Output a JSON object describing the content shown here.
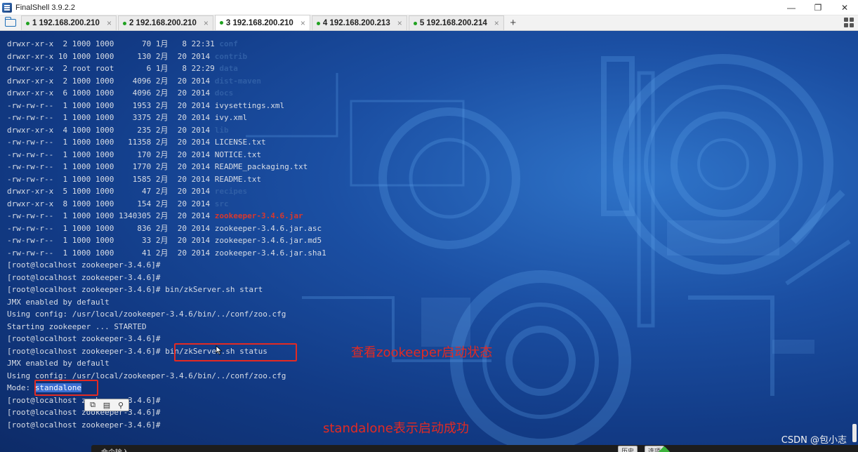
{
  "window": {
    "title": "FinalShell 3.9.2.2",
    "controls": {
      "minimize": "—",
      "maximize": "❐",
      "close": "✕"
    }
  },
  "tabs": [
    {
      "label": "1 192.168.200.210",
      "active": false,
      "close": "×"
    },
    {
      "label": "2 192.168.200.210",
      "active": false,
      "close": "×"
    },
    {
      "label": "3 192.168.200.210",
      "active": true,
      "close": "×"
    },
    {
      "label": "4 192.168.200.213",
      "active": false,
      "close": "×"
    },
    {
      "label": "5 192.168.200.214",
      "active": false,
      "close": "×"
    }
  ],
  "tab_add": "+",
  "terminal": {
    "listing": [
      {
        "meta": "drwxr-xr-x  2 1000 1000      70 1月   8 22:31 ",
        "name": "conf",
        "kind": "dir"
      },
      {
        "meta": "drwxr-xr-x 10 1000 1000     130 2月  20 2014 ",
        "name": "contrib",
        "kind": "dir"
      },
      {
        "meta": "drwxr-xr-x  2 root root       6 1月   8 22:29 ",
        "name": "data",
        "kind": "dir"
      },
      {
        "meta": "drwxr-xr-x  2 1000 1000    4096 2月  20 2014 ",
        "name": "dist-maven",
        "kind": "dir"
      },
      {
        "meta": "drwxr-xr-x  6 1000 1000    4096 2月  20 2014 ",
        "name": "docs",
        "kind": "dir"
      },
      {
        "meta": "-rw-rw-r--  1 1000 1000    1953 2月  20 2014 ",
        "name": "ivysettings.xml",
        "kind": "file"
      },
      {
        "meta": "-rw-rw-r--  1 1000 1000    3375 2月  20 2014 ",
        "name": "ivy.xml",
        "kind": "file"
      },
      {
        "meta": "drwxr-xr-x  4 1000 1000     235 2月  20 2014 ",
        "name": "lib",
        "kind": "dir"
      },
      {
        "meta": "-rw-rw-r--  1 1000 1000   11358 2月  20 2014 ",
        "name": "LICENSE.txt",
        "kind": "file"
      },
      {
        "meta": "-rw-rw-r--  1 1000 1000     170 2月  20 2014 ",
        "name": "NOTICE.txt",
        "kind": "file"
      },
      {
        "meta": "-rw-rw-r--  1 1000 1000    1770 2月  20 2014 ",
        "name": "README_packaging.txt",
        "kind": "file"
      },
      {
        "meta": "-rw-rw-r--  1 1000 1000    1585 2月  20 2014 ",
        "name": "README.txt",
        "kind": "file"
      },
      {
        "meta": "drwxr-xr-x  5 1000 1000      47 2月  20 2014 ",
        "name": "recipes",
        "kind": "dir"
      },
      {
        "meta": "drwxr-xr-x  8 1000 1000     154 2月  20 2014 ",
        "name": "src",
        "kind": "dir"
      },
      {
        "meta": "-rw-rw-r--  1 1000 1000 1340305 2月  20 2014 ",
        "name": "zookeeper-3.4.6.jar",
        "kind": "jar"
      },
      {
        "meta": "-rw-rw-r--  1 1000 1000     836 2月  20 2014 ",
        "name": "zookeeper-3.4.6.jar.asc",
        "kind": "file"
      },
      {
        "meta": "-rw-rw-r--  1 1000 1000      33 2月  20 2014 ",
        "name": "zookeeper-3.4.6.jar.md5",
        "kind": "file"
      },
      {
        "meta": "-rw-rw-r--  1 1000 1000      41 2月  20 2014 ",
        "name": "zookeeper-3.4.6.jar.sha1",
        "kind": "file"
      }
    ],
    "prompt": "[root@localhost zookeeper-3.4.6]# ",
    "session": [
      {
        "prompt": true,
        "cmd": ""
      },
      {
        "prompt": true,
        "cmd": ""
      },
      {
        "prompt": true,
        "cmd": "bin/zkServer.sh start"
      },
      {
        "prompt": false,
        "text": "JMX enabled by default"
      },
      {
        "prompt": false,
        "text": "Using config: /usr/local/zookeeper-3.4.6/bin/../conf/zoo.cfg"
      },
      {
        "prompt": false,
        "text": "Starting zookeeper ... STARTED"
      },
      {
        "prompt": true,
        "cmd": ""
      },
      {
        "prompt": true,
        "cmd": "bin/zkServer.sh status"
      },
      {
        "prompt": false,
        "text": "JMX enabled by default"
      },
      {
        "prompt": false,
        "text": "Using config: /usr/local/zookeeper-3.4.6/bin/../conf/zoo.cfg"
      },
      {
        "prompt": false,
        "text": "Mode: ",
        "highlight": "standalone"
      },
      {
        "prompt": true,
        "cmd": ""
      },
      {
        "prompt": true,
        "cmd": ""
      },
      {
        "prompt": true,
        "cmd": ""
      }
    ]
  },
  "annotations": {
    "status_note": "查看zookeeper启动状态",
    "success_note": "standalone表示启动成功"
  },
  "popup_toolbar": {
    "copy_icon": "⧉",
    "paste_icon": "▤",
    "search_icon": "⚲"
  },
  "command_bar": {
    "input_placeholder": "命令输入",
    "history_button": "历史",
    "options_button": "选项"
  },
  "watermark": "CSDN @包小志",
  "colors": {
    "annotation_red": "#e32a22",
    "dir_blue": "#2f5ea6",
    "jar_red": "#d8382d",
    "terminal_bg": "#1b4fa3"
  }
}
